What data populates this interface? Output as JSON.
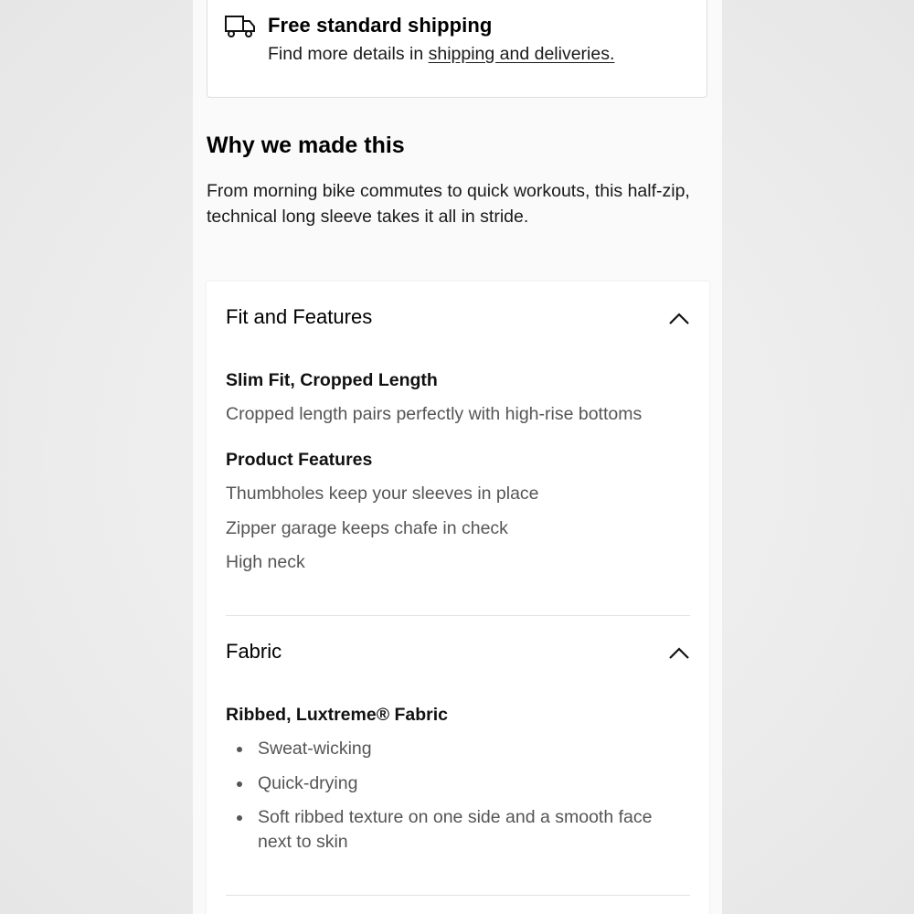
{
  "shipping": {
    "icon": "truck-icon",
    "title": "Free standard shipping",
    "details_prefix": "Find more details in",
    "details_link": "shipping and deliveries."
  },
  "why": {
    "title": "Why we made this",
    "body": "From morning bike commutes to quick workouts, this half-zip, technical long sleeve takes it all in stride."
  },
  "fit": {
    "header": "Fit and Features",
    "expanded": true,
    "fit_title": "Slim Fit, Cropped Length",
    "fit_desc": "Cropped length pairs perfectly with high-rise bottoms",
    "features_title": "Product Features",
    "features": [
      "Thumbholes keep your sleeves in place",
      "Zipper garage keeps chafe in check",
      "High neck"
    ]
  },
  "fabric": {
    "header": "Fabric",
    "expanded": true,
    "title": "Ribbed, Luxtreme® Fabric",
    "bullets": [
      "Sweat-wicking",
      "Quick-drying",
      "Soft ribbed texture on one side and a smooth face next to skin"
    ]
  }
}
